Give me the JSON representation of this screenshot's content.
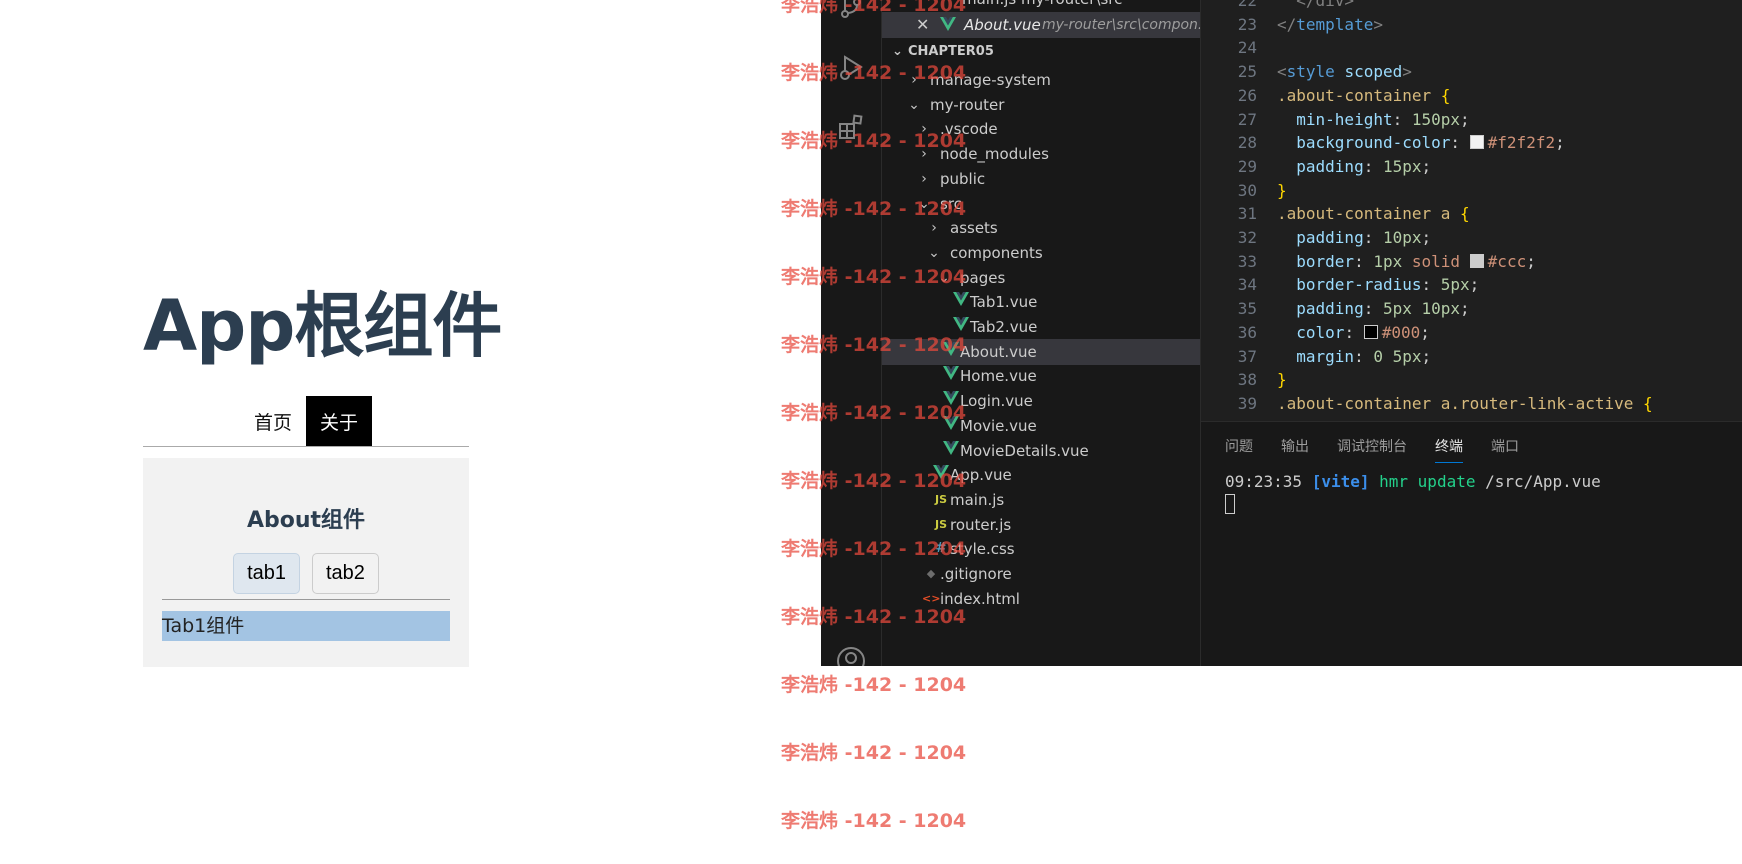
{
  "app": {
    "title": "App根组件",
    "nav": [
      {
        "label": "首页",
        "active": false
      },
      {
        "label": "关于",
        "active": true
      }
    ],
    "about": {
      "heading": "About组件",
      "tabs": [
        {
          "label": "tab1",
          "active": true
        },
        {
          "label": "tab2",
          "active": false
        }
      ],
      "content": "Tab1组件"
    }
  },
  "vscode": {
    "open_editors": {
      "top_partial": "main.js  my-router\\src",
      "active": {
        "name": "About.vue",
        "path": "my-router\\src\\compon..."
      }
    },
    "explorer": {
      "section": "CHAPTER05",
      "items": [
        {
          "label": "manage-system",
          "kind": "folder",
          "expanded": false
        },
        {
          "label": "my-router",
          "kind": "folder",
          "expanded": true
        },
        {
          "label": ".vscode",
          "kind": "folder",
          "expanded": false
        },
        {
          "label": "node_modules",
          "kind": "folder",
          "expanded": false
        },
        {
          "label": "public",
          "kind": "folder",
          "expanded": false
        },
        {
          "label": "src",
          "kind": "folder",
          "expanded": true
        },
        {
          "label": "assets",
          "kind": "folder",
          "expanded": false
        },
        {
          "label": "components",
          "kind": "folder",
          "expanded": true
        },
        {
          "label": "pages",
          "kind": "folder",
          "expanded": true
        },
        {
          "label": "Tab1.vue",
          "kind": "vue"
        },
        {
          "label": "Tab2.vue",
          "kind": "vue"
        },
        {
          "label": "About.vue",
          "kind": "vue",
          "selected": true
        },
        {
          "label": "Home.vue",
          "kind": "vue"
        },
        {
          "label": "Login.vue",
          "kind": "vue"
        },
        {
          "label": "Movie.vue",
          "kind": "vue"
        },
        {
          "label": "MovieDetails.vue",
          "kind": "vue"
        },
        {
          "label": "App.vue",
          "kind": "vue"
        },
        {
          "label": "main.js",
          "kind": "js"
        },
        {
          "label": "router.js",
          "kind": "js"
        },
        {
          "label": "style.css",
          "kind": "css"
        },
        {
          "label": ".gitignore",
          "kind": "git"
        },
        {
          "label": "index.html",
          "kind": "html"
        }
      ]
    },
    "editor": {
      "lines": [
        {
          "n": "22",
          "tokens": [
            [
              "  </div>",
              "#808080"
            ]
          ]
        },
        {
          "n": "23",
          "tokens": [
            [
              "</",
              "#808080"
            ],
            [
              "template",
              "#569cd6"
            ],
            [
              ">",
              "#808080"
            ]
          ]
        },
        {
          "n": "24",
          "tokens": []
        },
        {
          "n": "25",
          "tokens": [
            [
              "<",
              "#808080"
            ],
            [
              "style",
              "#569cd6"
            ],
            [
              " ",
              "#cccccc"
            ],
            [
              "scoped",
              "#9cdcfe"
            ],
            [
              ">",
              "#808080"
            ]
          ]
        },
        {
          "n": "26",
          "tokens": [
            [
              ".about-container",
              "#d7ba7d"
            ],
            [
              " {",
              "#ffd700"
            ]
          ]
        },
        {
          "n": "27",
          "tokens": [
            [
              "  min-height",
              "#9cdcfe"
            ],
            [
              ": ",
              "#cccccc"
            ],
            [
              "150px",
              "#b5cea8"
            ],
            [
              ";",
              "#cccccc"
            ]
          ]
        },
        {
          "n": "28",
          "tokens": [
            [
              "  background-color",
              "#9cdcfe"
            ],
            [
              ": ",
              "#cccccc"
            ],
            [
              "#swatch:#f2f2f2",
              ""
            ],
            [
              "#f2f2f2",
              "#ce9178"
            ],
            [
              ";",
              "#cccccc"
            ]
          ]
        },
        {
          "n": "29",
          "tokens": [
            [
              "  padding",
              "#9cdcfe"
            ],
            [
              ": ",
              "#cccccc"
            ],
            [
              "15px",
              "#b5cea8"
            ],
            [
              ";",
              "#cccccc"
            ]
          ]
        },
        {
          "n": "30",
          "tokens": [
            [
              "}",
              "#ffd700"
            ]
          ]
        },
        {
          "n": "31",
          "tokens": [
            [
              ".about-container a",
              "#d7ba7d"
            ],
            [
              " {",
              "#ffd700"
            ]
          ]
        },
        {
          "n": "32",
          "tokens": [
            [
              "  padding",
              "#9cdcfe"
            ],
            [
              ": ",
              "#cccccc"
            ],
            [
              "10px",
              "#b5cea8"
            ],
            [
              ";",
              "#cccccc"
            ]
          ]
        },
        {
          "n": "33",
          "tokens": [
            [
              "  border",
              "#9cdcfe"
            ],
            [
              ": ",
              "#cccccc"
            ],
            [
              "1px",
              "#b5cea8"
            ],
            [
              " solid ",
              "#ce9178"
            ],
            [
              "#swatch:#ccc",
              ""
            ],
            [
              "#ccc",
              "#ce9178"
            ],
            [
              ";",
              "#cccccc"
            ]
          ]
        },
        {
          "n": "34",
          "tokens": [
            [
              "  border-radius",
              "#9cdcfe"
            ],
            [
              ": ",
              "#cccccc"
            ],
            [
              "5px",
              "#b5cea8"
            ],
            [
              ";",
              "#cccccc"
            ]
          ]
        },
        {
          "n": "35",
          "tokens": [
            [
              "  padding",
              "#9cdcfe"
            ],
            [
              ": ",
              "#cccccc"
            ],
            [
              "5px 10px",
              "#b5cea8"
            ],
            [
              ";",
              "#cccccc"
            ]
          ]
        },
        {
          "n": "36",
          "tokens": [
            [
              "  color",
              "#9cdcfe"
            ],
            [
              ": ",
              "#cccccc"
            ],
            [
              "#swatch:#000",
              ""
            ],
            [
              "#000",
              "#ce9178"
            ],
            [
              ";",
              "#cccccc"
            ]
          ]
        },
        {
          "n": "37",
          "tokens": [
            [
              "  margin",
              "#9cdcfe"
            ],
            [
              ": ",
              "#cccccc"
            ],
            [
              "0 5px",
              "#b5cea8"
            ],
            [
              ";",
              "#cccccc"
            ]
          ]
        },
        {
          "n": "38",
          "tokens": [
            [
              "}",
              "#ffd700"
            ]
          ]
        },
        {
          "n": "39",
          "tokens": [
            [
              ".about-container a.router-link-active",
              "#d7ba7d"
            ],
            [
              " {",
              "#ffd700"
            ]
          ]
        }
      ]
    },
    "panel": {
      "tabs": [
        {
          "label": "问题",
          "active": false
        },
        {
          "label": "输出",
          "active": false
        },
        {
          "label": "调试控制台",
          "active": false
        },
        {
          "label": "终端",
          "active": true
        },
        {
          "label": "端口",
          "active": false
        }
      ],
      "terminal": {
        "time": "09:23:35",
        "tag": "[vite]",
        "msg": "hmr update",
        "file": "/src/App.vue"
      }
    }
  },
  "watermark": {
    "text": "李浩炜 -142 - 1204",
    "count": 13,
    "color": "#e8493c"
  },
  "icons": {
    "vue": "vue-icon",
    "js": "js-icon",
    "css": "css-icon",
    "git": "git-icon",
    "html": "html-icon"
  }
}
